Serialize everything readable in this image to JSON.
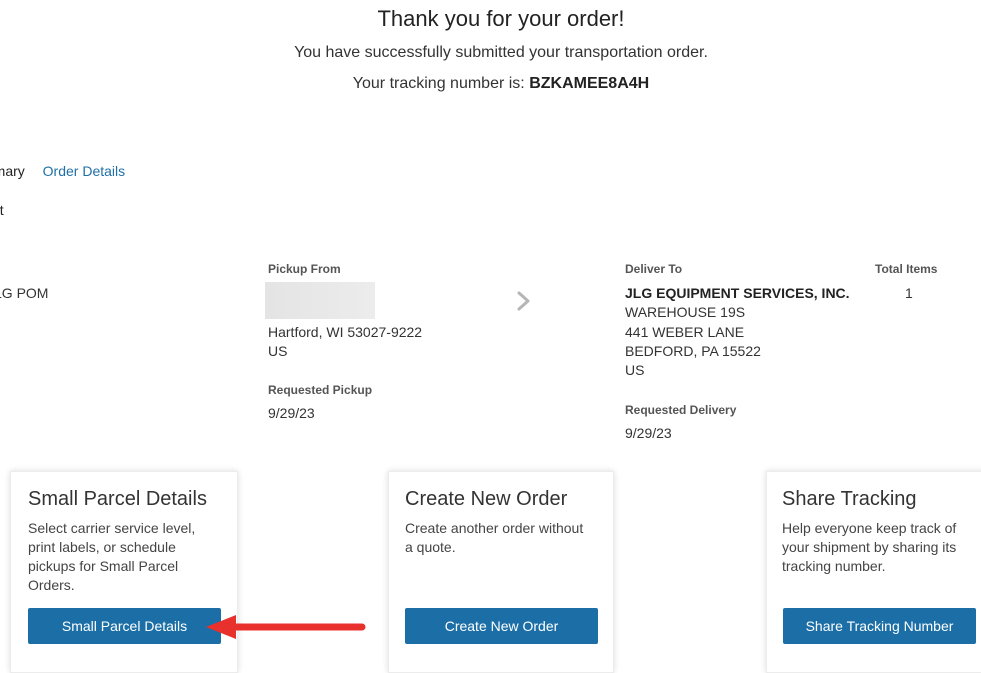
{
  "header": {
    "title": "Thank you for your order!",
    "subtitle": "You have successfully submitted your transportation order.",
    "tracking_prefix": "Your tracking number is:",
    "tracking_number": "BZKAMEE8A4H"
  },
  "tabs": [
    {
      "label": "mmary",
      "active": true
    },
    {
      "label": "Order Details",
      "active": false
    }
  ],
  "section_label": "nt",
  "shipment": {
    "shipper_partial": "LG POM",
    "pickup": {
      "label": "Pickup From",
      "city_line": "Hartford, WI 53027-9222",
      "country": "US",
      "requested_label": "Requested Pickup",
      "requested_date": "9/29/23"
    },
    "deliver": {
      "label": "Deliver To",
      "company": "JLG EQUIPMENT SERVICES, INC.",
      "line1": "WAREHOUSE 19S",
      "line2": "441 WEBER LANE",
      "line3": "BEDFORD, PA 15522",
      "country": "US",
      "requested_label": "Requested Delivery",
      "requested_date": "9/29/23"
    },
    "total": {
      "label": "Total Items",
      "value": "1"
    }
  },
  "cards": [
    {
      "title": "Small Parcel Details",
      "desc_lines": [
        "Select carrier service level,",
        "print labels, or schedule",
        "pickups for Small Parcel",
        "Orders."
      ],
      "button": "Small Parcel Details"
    },
    {
      "title": "Create New Order",
      "desc_lines": [
        "Create another order without",
        "a quote."
      ],
      "button": "Create New Order"
    },
    {
      "title": "Share Tracking",
      "desc_lines": [
        "Help everyone keep track of",
        "your shipment by sharing its",
        "tracking number."
      ],
      "button": "Share Tracking Number"
    }
  ],
  "colors": {
    "accent": "#1b6fa6",
    "link": "#1f6fa6",
    "annotation_arrow": "#e8312c"
  },
  "icons": {
    "chevron": "chevron-right-icon",
    "arrow": "red-annotation-arrow"
  }
}
